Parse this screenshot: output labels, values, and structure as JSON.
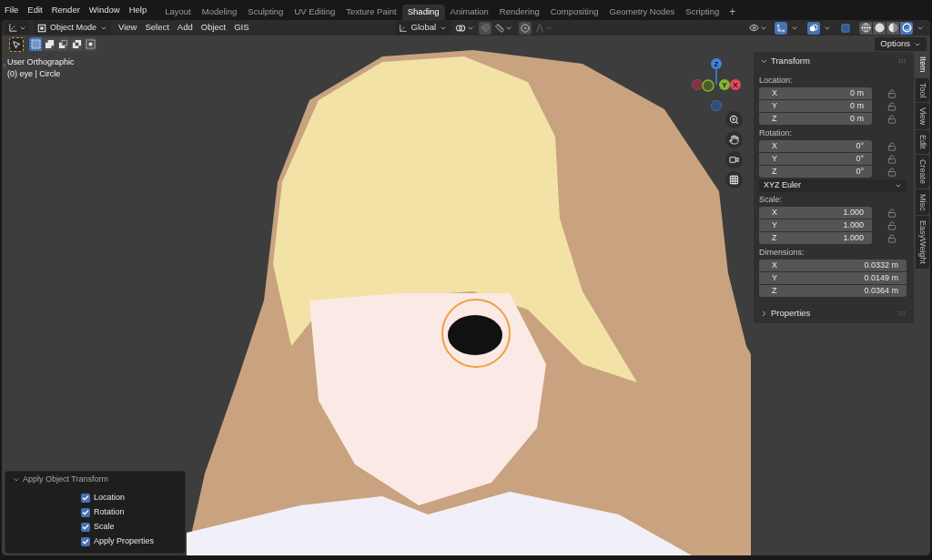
{
  "menu_bar": {
    "menus": [
      "File",
      "Edit",
      "Render",
      "Window",
      "Help"
    ],
    "workspaces": [
      {
        "label": "Layout",
        "selected": false
      },
      {
        "label": "Modeling",
        "selected": false
      },
      {
        "label": "Sculpting",
        "selected": false
      },
      {
        "label": "UV Editing",
        "selected": false
      },
      {
        "label": "Texture Paint",
        "selected": false
      },
      {
        "label": "Shading",
        "selected": true
      },
      {
        "label": "Animation",
        "selected": false
      },
      {
        "label": "Rendering",
        "selected": false
      },
      {
        "label": "Compositing",
        "selected": false
      },
      {
        "label": "Geometry Nodes",
        "selected": false
      },
      {
        "label": "Scripting",
        "selected": false
      }
    ],
    "add_workspace": "+"
  },
  "header": {
    "mode": "Object Mode",
    "menus": [
      "View",
      "Select",
      "Add",
      "Object",
      "GIS"
    ],
    "orientation": "Global",
    "snap": {
      "on": false
    },
    "proportional_editing": {
      "on": false
    },
    "gizmos": {
      "on": true
    },
    "overlays": {
      "on": true
    },
    "xray": {
      "on": false
    },
    "shading_modes": [
      {
        "selected": false
      },
      {
        "selected": false
      },
      {
        "selected": false
      },
      {
        "selected": true
      }
    ]
  },
  "tool_header": {
    "select_modes": [
      {
        "selected": true
      },
      {
        "selected": false
      },
      {
        "selected": false
      },
      {
        "selected": false
      },
      {
        "selected": false
      }
    ],
    "options": "Options"
  },
  "viewport": {
    "view_name": "User Orthographic",
    "object_info": "(0) eye | Circle",
    "gizmo_axes": [
      "Z",
      "Y",
      "X"
    ]
  },
  "sidebar": {
    "tabs": [
      {
        "label": "Item",
        "selected": true
      },
      {
        "label": "Tool",
        "selected": false
      },
      {
        "label": "View",
        "selected": false
      },
      {
        "label": "Edit",
        "selected": false
      },
      {
        "label": "Create",
        "selected": false
      },
      {
        "label": "Misc",
        "selected": false
      },
      {
        "label": "EasyWeight",
        "selected": false
      }
    ],
    "transform": {
      "title": "Transform",
      "expanded": true,
      "location": {
        "label": "Location:",
        "rows": [
          {
            "axis": "X",
            "value": "0 m",
            "locked": false
          },
          {
            "axis": "Y",
            "value": "0 m",
            "locked": false
          },
          {
            "axis": "Z",
            "value": "0 m",
            "locked": false
          }
        ]
      },
      "rotation": {
        "label": "Rotation:",
        "rows": [
          {
            "axis": "X",
            "value": "0°",
            "locked": false
          },
          {
            "axis": "Y",
            "value": "0°",
            "locked": false
          },
          {
            "axis": "Z",
            "value": "0°",
            "locked": false
          }
        ]
      },
      "rotation_mode": "XYZ Euler",
      "scale": {
        "label": "Scale:",
        "rows": [
          {
            "axis": "X",
            "value": "1.000",
            "locked": false
          },
          {
            "axis": "Y",
            "value": "1.000",
            "locked": false
          },
          {
            "axis": "Z",
            "value": "1.000",
            "locked": false
          }
        ]
      },
      "dimensions": {
        "label": "Dimensions:",
        "rows": [
          {
            "axis": "X",
            "value": "0.0332 m"
          },
          {
            "axis": "Y",
            "value": "0.0149 m"
          },
          {
            "axis": "Z",
            "value": "0.0364 m"
          }
        ]
      }
    },
    "properties": {
      "title": "Properties",
      "expanded": false
    }
  },
  "operator_panel": {
    "title": "Apply Object Transform",
    "expanded": true,
    "options": [
      {
        "label": "Location",
        "checked": true
      },
      {
        "label": "Rotation",
        "checked": true
      },
      {
        "label": "Scale",
        "checked": true
      },
      {
        "label": "Apply Properties",
        "checked": true
      }
    ]
  }
}
